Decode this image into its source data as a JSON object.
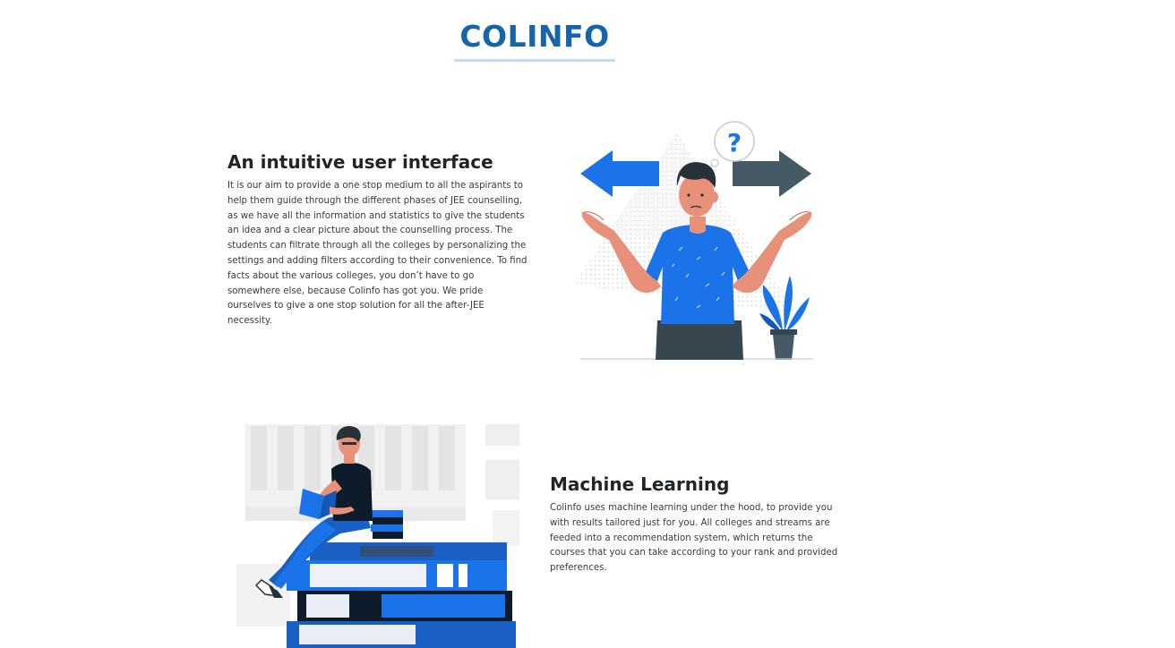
{
  "header": {
    "title": "COLINFO"
  },
  "sections": [
    {
      "heading": "An intuitive user interface",
      "text": "It is our aim to provide a one stop medium to all the aspirants to help them guide through the different phases of JEE counselling, as we have all the information and statistics to give the students an idea and a clear picture about the counselling process. The students can filtrate through all the colleges by personalizing the settings and adding filters according to their convenience. To find facts about the various colleges, you don’t have to go somewhere else, because Colinfo has got you. We pride ourselves to give a one stop solution for all the after-JEE necessity.",
      "illustration": {
        "icon": "confused-person-illustration",
        "bubble_text": "?"
      }
    },
    {
      "heading": "Machine Learning",
      "text": "Colinfo uses machine learning under the hood, to provide you with results tailored just for you. All colleges and streams are feeded into a recommendation system, which returns the courses that you can take according to your rank and provided preferences.",
      "illustration": {
        "icon": "person-reading-on-books-illustration"
      }
    }
  ],
  "colors": {
    "brand": "#1565a8",
    "accent_blue": "#1a73e8",
    "dark_slate": "#37474f",
    "skin": "#e7907a",
    "heading": "#212529",
    "body_text": "#3a3a3a",
    "underline": "#c4ddf4"
  }
}
